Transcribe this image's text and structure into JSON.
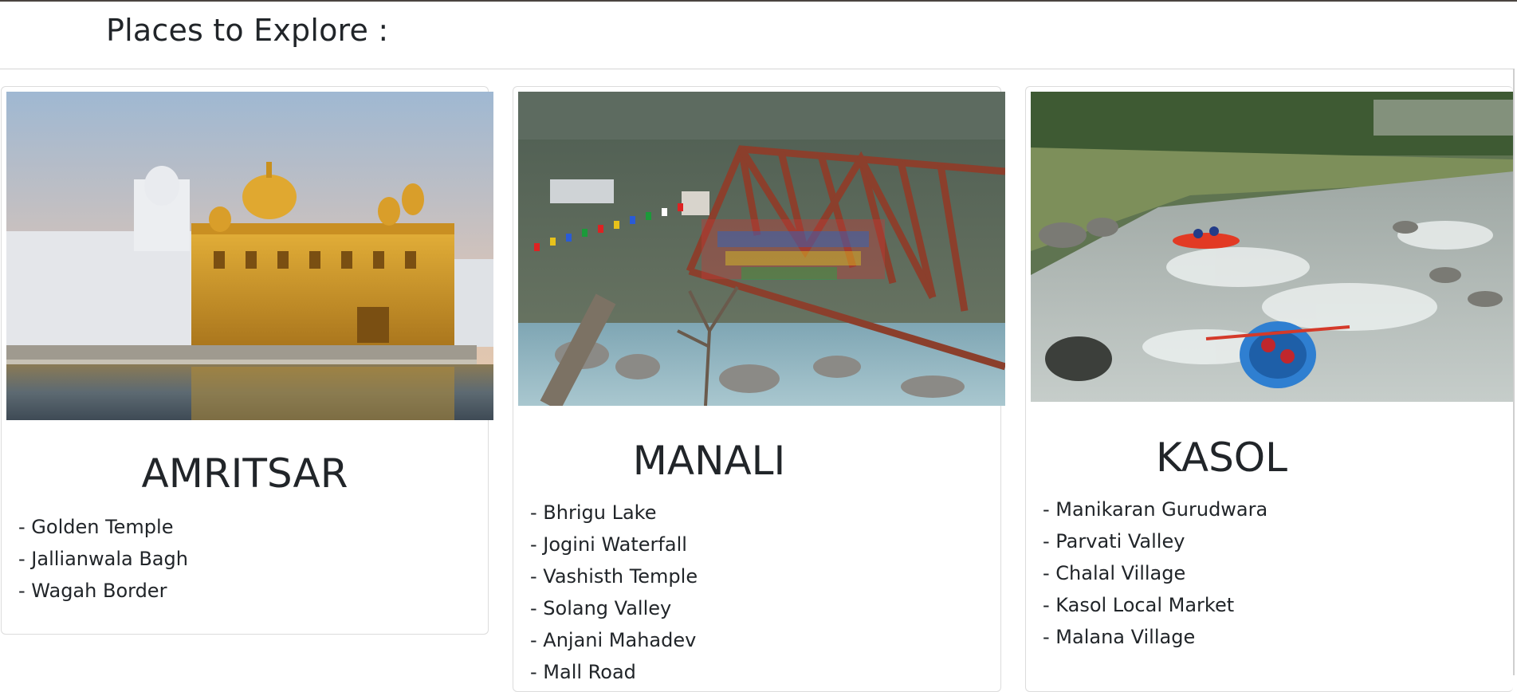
{
  "header": {
    "title": "Places to Explore :"
  },
  "cards": [
    {
      "title": "AMRITSAR",
      "image_icon": "golden-temple-photo",
      "items": [
        "- Golden Temple",
        "- Jallianwala Bagh",
        "- Wagah Border"
      ]
    },
    {
      "title": "MANALI",
      "image_icon": "manali-bridge-photo",
      "items": [
        "- Bhrigu Lake",
        "- Jogini Waterfall",
        "- Vashisth Temple",
        "- Solang Valley",
        "- Anjani Mahadev",
        "- Mall Road"
      ]
    },
    {
      "title": "KASOL",
      "image_icon": "kasol-river-rafting-photo",
      "items": [
        "- Manikaran Gurudwara",
        "- Parvati Valley",
        "- Chalal Village",
        "- Kasol Local Market",
        "- Malana Village"
      ]
    }
  ]
}
